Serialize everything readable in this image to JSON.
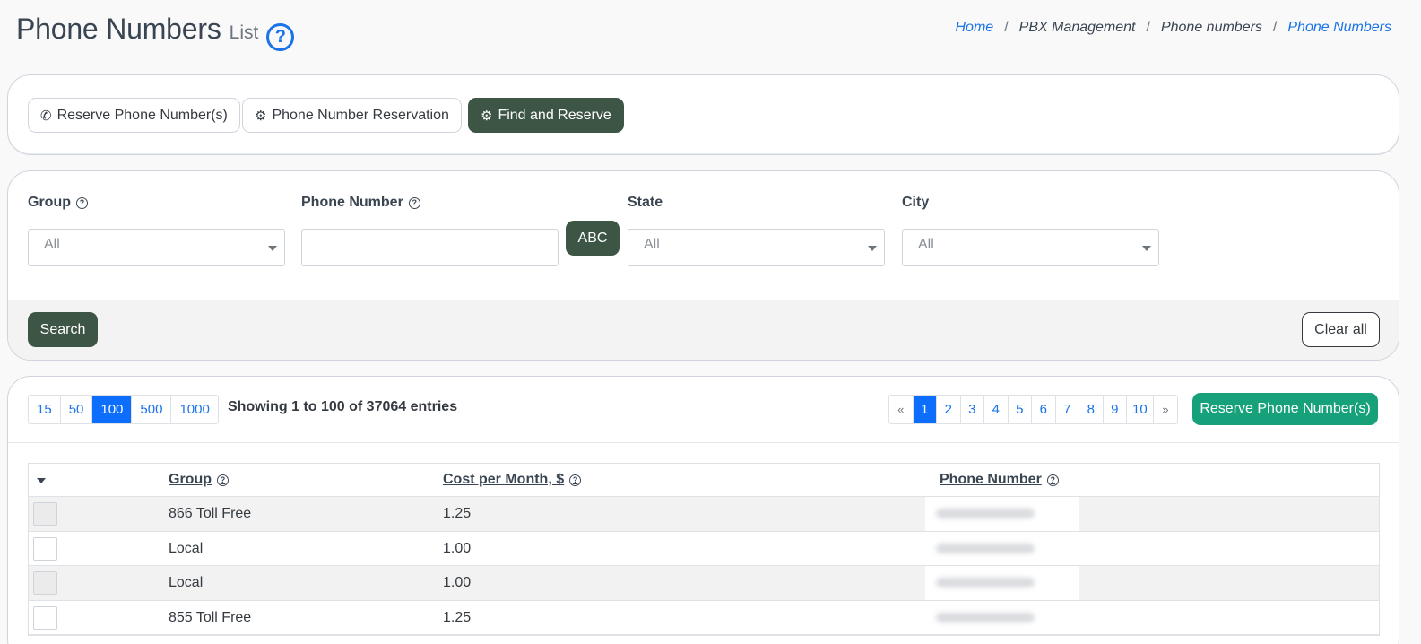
{
  "header": {
    "title": "Phone Numbers",
    "subtitle": "List",
    "help_icon": "question-circle-icon"
  },
  "breadcrumb": [
    {
      "label": "Home",
      "link": true
    },
    {
      "label": "PBX Management",
      "link": false
    },
    {
      "label": "Phone numbers",
      "link": false
    },
    {
      "label": "Phone Numbers",
      "link": true
    }
  ],
  "tabs": [
    {
      "label": "Reserve Phone Number(s)",
      "icon": "phone-icon",
      "active": false
    },
    {
      "label": "Phone Number Reservation",
      "icon": "gears-icon",
      "active": false
    },
    {
      "label": "Find and Reserve",
      "icon": "gears-icon",
      "active": true
    }
  ],
  "filters": {
    "group": {
      "label": "Group",
      "value": "All"
    },
    "phone_number": {
      "label": "Phone Number",
      "value": ""
    },
    "abc_button": "ABC",
    "state": {
      "label": "State",
      "value": "All"
    },
    "city": {
      "label": "City",
      "value": "All"
    },
    "search_button": "Search",
    "clear_button": "Clear all"
  },
  "table_controls": {
    "page_sizes": [
      "15",
      "50",
      "100",
      "500",
      "1000"
    ],
    "active_page_size": "100",
    "showing_text": "Showing 1 to 100 of 37064 entries",
    "pager": {
      "prev": "«",
      "pages": [
        "1",
        "2",
        "3",
        "4",
        "5",
        "6",
        "7",
        "8",
        "9",
        "10"
      ],
      "active": "1",
      "next": "»"
    },
    "reserve_button": "Reserve Phone Number(s)"
  },
  "table": {
    "columns": {
      "group": "Group",
      "cost": "Cost per Month, $",
      "phone": "Phone Number"
    },
    "rows": [
      {
        "group": "866 Toll Free",
        "cost": "1.25"
      },
      {
        "group": "Local",
        "cost": "1.00"
      },
      {
        "group": "Local",
        "cost": "1.00"
      },
      {
        "group": "855 Toll Free",
        "cost": "1.25"
      }
    ]
  },
  "colors": {
    "primary_dark": "#3d5545",
    "accent_blue": "#1a73e8",
    "reserve_green": "#17a17a"
  }
}
